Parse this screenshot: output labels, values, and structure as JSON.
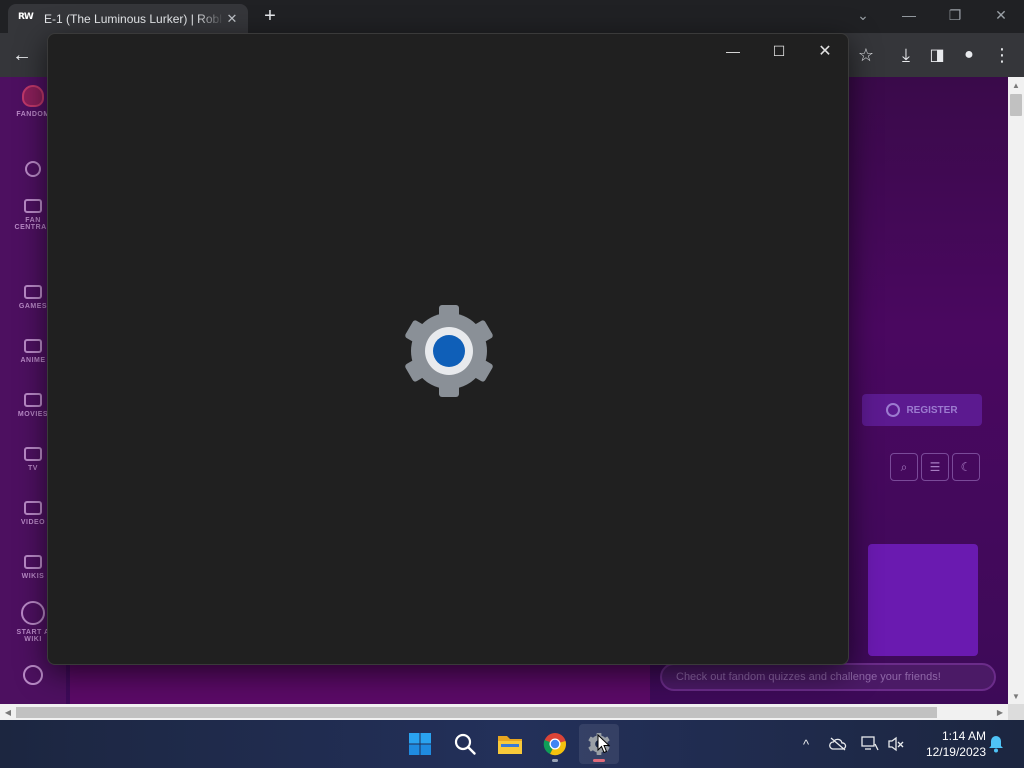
{
  "browser": {
    "tab": {
      "favicon_text": "RW",
      "title": "E-1 (The Luminous Lurker) | Robl",
      "close_glyph": "✕"
    },
    "new_tab_glyph": "+",
    "window_controls": {
      "tab_search": "⌄",
      "minimize": "—",
      "restore": "❐",
      "close": "✕"
    },
    "toolbar": {
      "back": "←",
      "bookmark": "☆",
      "download": "⤓",
      "side_panel": "◨",
      "profile": "●",
      "menu": "⋮"
    }
  },
  "webpage": {
    "sidebar": [
      {
        "label": "FANDOM"
      },
      {
        "label": "FAN CENTRAL"
      },
      {
        "label": "GAMES"
      },
      {
        "label": "ANIME"
      },
      {
        "label": "MOVIES"
      },
      {
        "label": "TV"
      },
      {
        "label": "VIDEO"
      },
      {
        "label": "WIKIS"
      },
      {
        "label": "START A WIKI"
      }
    ],
    "register_label": "REGISTER",
    "pill_text": "Check out fandom quizzes and challenge your friends!",
    "icon_buttons": [
      "⌕",
      "☰",
      "☾"
    ]
  },
  "settings_window": {
    "controls": {
      "minimize": "—",
      "maximize": "☐",
      "close": "✕"
    },
    "logo_icon": "gear-icon",
    "colors": {
      "gear": "#8a9097",
      "ring": "#e8eaed",
      "center": "#0f5fb8"
    }
  },
  "taskbar": {
    "apps": [
      {
        "name": "start",
        "icon": "windows-logo-icon"
      },
      {
        "name": "search",
        "icon": "search-icon"
      },
      {
        "name": "file-explorer",
        "icon": "folder-icon"
      },
      {
        "name": "chrome",
        "icon": "chrome-icon"
      },
      {
        "name": "settings",
        "icon": "gear-icon"
      }
    ],
    "tray": {
      "overflow": "^",
      "time": "1:14 AM",
      "date": "12/19/2023"
    }
  }
}
